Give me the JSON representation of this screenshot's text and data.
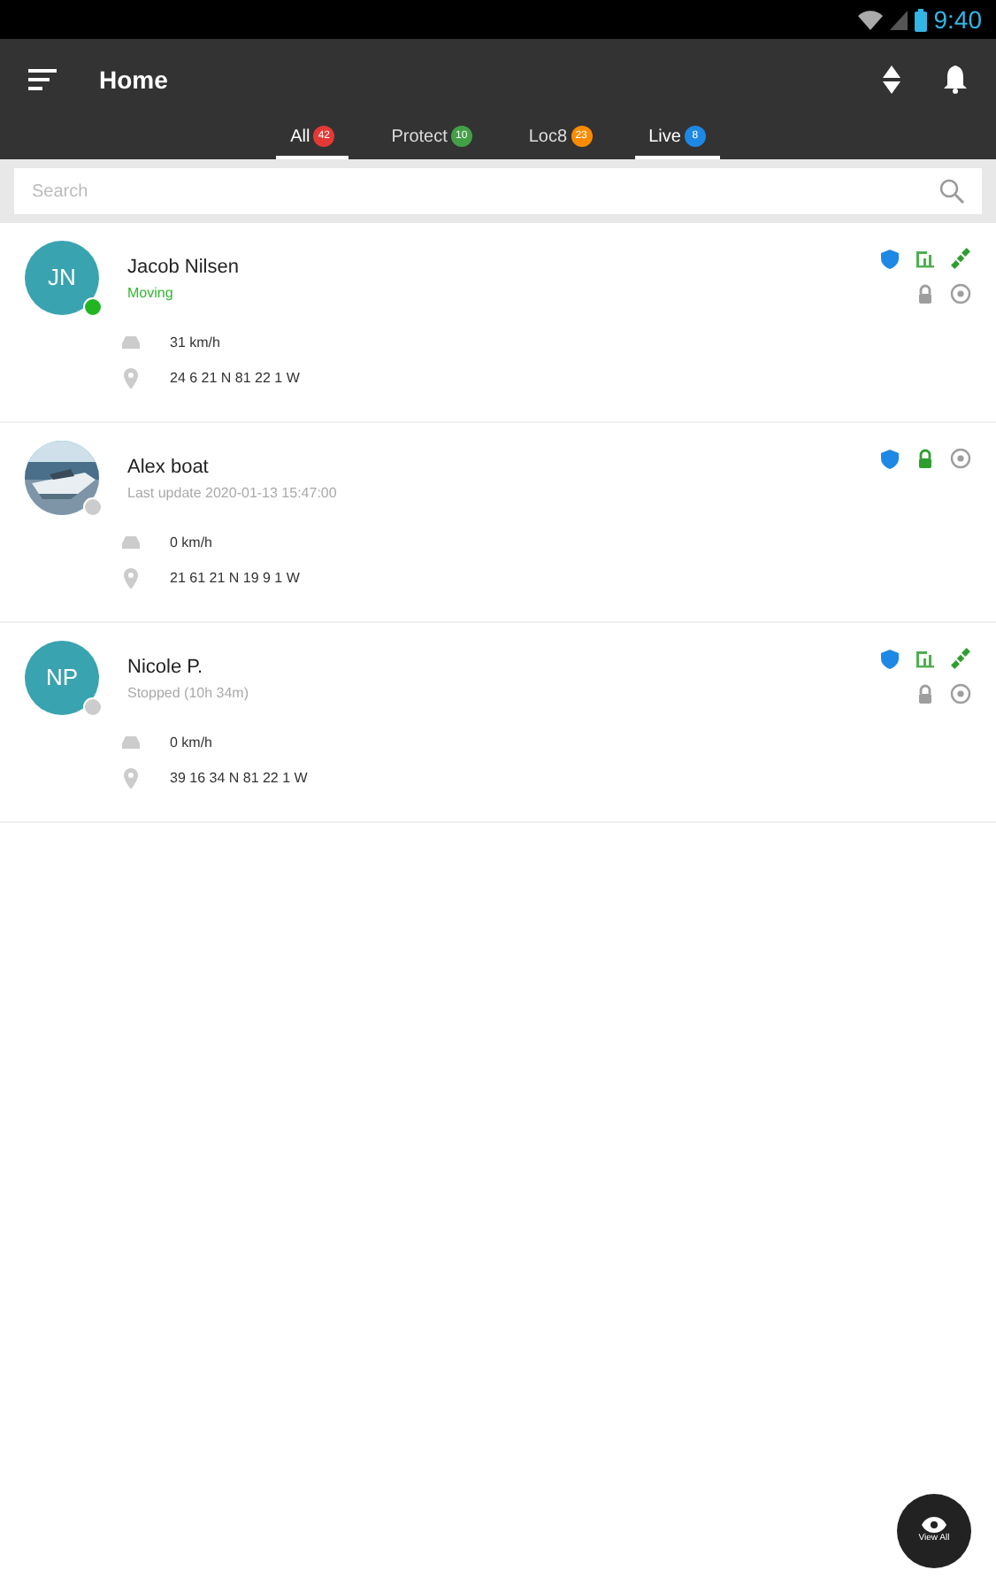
{
  "status_bar": {
    "time": "9:40"
  },
  "app_bar": {
    "title": "Home"
  },
  "tabs": [
    {
      "label": "All",
      "count": "42",
      "color": "#e53935",
      "selected": true
    },
    {
      "label": "Protect",
      "count": "10",
      "color": "#43a047",
      "selected": false
    },
    {
      "label": "Loc8",
      "count": "23",
      "color": "#fb8c00",
      "selected": false
    },
    {
      "label": "Live",
      "count": "8",
      "color": "#1e88e5",
      "selected": true
    }
  ],
  "search": {
    "placeholder": "Search"
  },
  "devices": [
    {
      "name": "Jacob Nilsen",
      "avatar": {
        "kind": "initials",
        "initials": "JN"
      },
      "color": "#22b522",
      "status": "Moving",
      "moving": true,
      "speed": "31 km/h",
      "position": "24 6 21 N 81 22 1 W",
      "icons": [
        {
          "kind": "shield",
          "color": "#1e88e5"
        },
        {
          "kind": "signal",
          "color": "#4caf50"
        },
        {
          "kind": "satellite",
          "color": "#2e9e2e"
        },
        {
          "kind": "lock",
          "color": "#9e9e9e"
        },
        {
          "kind": "target",
          "color": "#9e9e9e"
        }
      ]
    },
    {
      "name": "Alex boat",
      "avatar": {
        "kind": "picture"
      },
      "color": "#cccccc",
      "status": "Last update 2020-01-13 15:47:00",
      "moving": false,
      "speed": "0 km/h",
      "position": "21 61 21 N 19 9 1 W",
      "icons": [
        {
          "kind": "shield",
          "color": "#1e88e5"
        },
        {
          "kind": "lock",
          "color": "#2e9e2e"
        },
        {
          "kind": "target",
          "color": "#9e9e9e"
        }
      ]
    },
    {
      "name": "Nicole P.",
      "avatar": {
        "kind": "initials",
        "initials": "NP"
      },
      "color": "#cccccc",
      "status": "Stopped (10h 34m)",
      "moving": false,
      "speed": "0 km/h",
      "position": "39 16 34 N 81 22 1 W",
      "icons": [
        {
          "kind": "shield",
          "color": "#1e88e5"
        },
        {
          "kind": "signal",
          "color": "#4caf50"
        },
        {
          "kind": "satellite",
          "color": "#2e9e2e"
        },
        {
          "kind": "lock",
          "color": "#9e9e9e"
        },
        {
          "kind": "target",
          "color": "#9e9e9e"
        }
      ]
    }
  ],
  "fab": {
    "label": "View All"
  }
}
